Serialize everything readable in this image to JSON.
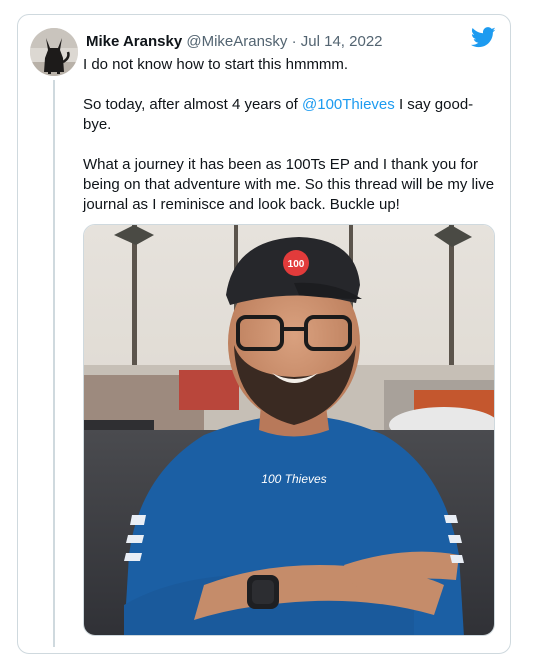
{
  "tweet": {
    "author_name": "Mike Aransky",
    "handle": "@MikeAransky",
    "separator": "·",
    "date": "Jul 14, 2022",
    "line1": "I do not know how to start this hmmmm.",
    "line2_before": "So today, after almost 4 years of ",
    "mention": "@100Thieves",
    "line2_after": "  I say good-bye.",
    "line3": "What a journey it has been as 100Ts EP and I thank you for being on that adventure with me. So this thread will be my live journal as I reminisce and look back. Buckle up!",
    "cap_logo_text": "100",
    "shirt_logo_text": "100 Thieves"
  },
  "icons": {
    "bird": "twitter-bird-icon"
  },
  "colors": {
    "accent": "#1d9bf0",
    "text": "#0f1419",
    "muted": "#536471",
    "border": "#cfd9de",
    "shirt": "#1b5fa4"
  }
}
